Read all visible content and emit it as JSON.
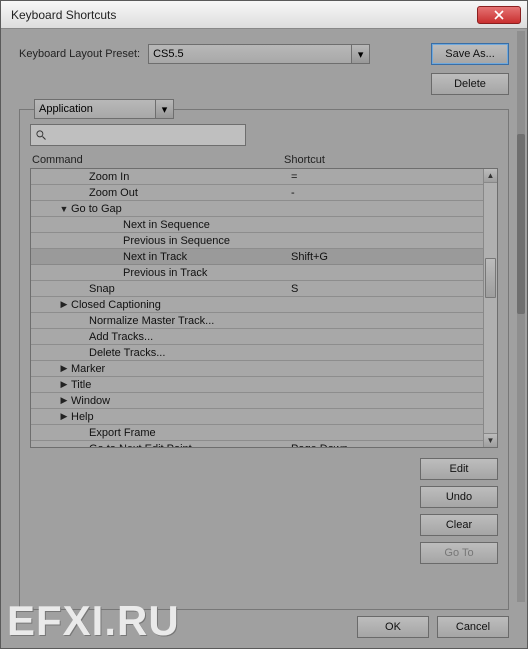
{
  "window": {
    "title": "Keyboard Shortcuts"
  },
  "preset": {
    "label": "Keyboard Layout Preset:",
    "value": "CS5.5",
    "saveAs": "Save As...",
    "delete": "Delete"
  },
  "scope": {
    "value": "Application"
  },
  "search": {
    "placeholder": ""
  },
  "headers": {
    "command": "Command",
    "shortcut": "Shortcut"
  },
  "rows": [
    {
      "indent": 1,
      "arrow": "",
      "cmd": "Zoom In",
      "sc": "="
    },
    {
      "indent": 1,
      "arrow": "",
      "cmd": "Zoom Out",
      "sc": "-"
    },
    {
      "indent": 2,
      "arrow": "▼",
      "cmd": "Go to Gap",
      "sc": ""
    },
    {
      "indent": 3,
      "arrow": "",
      "cmd": "Next in Sequence",
      "sc": ""
    },
    {
      "indent": 3,
      "arrow": "",
      "cmd": "Previous in Sequence",
      "sc": ""
    },
    {
      "indent": 3,
      "arrow": "",
      "cmd": "Next in Track",
      "sc": "Shift+G",
      "selected": true
    },
    {
      "indent": 3,
      "arrow": "",
      "cmd": "Previous in Track",
      "sc": ""
    },
    {
      "indent": 1,
      "arrow": "",
      "cmd": "Snap",
      "sc": "S"
    },
    {
      "indent": 2,
      "arrow": "▶",
      "cmd": "Closed Captioning",
      "sc": ""
    },
    {
      "indent": 1,
      "arrow": "",
      "cmd": "Normalize Master Track...",
      "sc": ""
    },
    {
      "indent": 1,
      "arrow": "",
      "cmd": "Add Tracks...",
      "sc": ""
    },
    {
      "indent": 1,
      "arrow": "",
      "cmd": "Delete Tracks...",
      "sc": ""
    },
    {
      "indent": 2,
      "arrow": "▶",
      "cmd": "Marker",
      "sc": ""
    },
    {
      "indent": 2,
      "arrow": "▶",
      "cmd": "Title",
      "sc": ""
    },
    {
      "indent": 2,
      "arrow": "▶",
      "cmd": "Window",
      "sc": ""
    },
    {
      "indent": 2,
      "arrow": "▶",
      "cmd": "Help",
      "sc": ""
    },
    {
      "indent": 1,
      "arrow": "",
      "cmd": "Export Frame",
      "sc": ""
    },
    {
      "indent": 1,
      "arrow": "",
      "cmd": "Go to Next Edit Point",
      "sc": "Page Down"
    }
  ],
  "actions": {
    "edit": "Edit",
    "undo": "Undo",
    "clear": "Clear",
    "goto": "Go To"
  },
  "footer": {
    "ok": "OK",
    "cancel": "Cancel"
  },
  "watermark": "EFXI.RU"
}
